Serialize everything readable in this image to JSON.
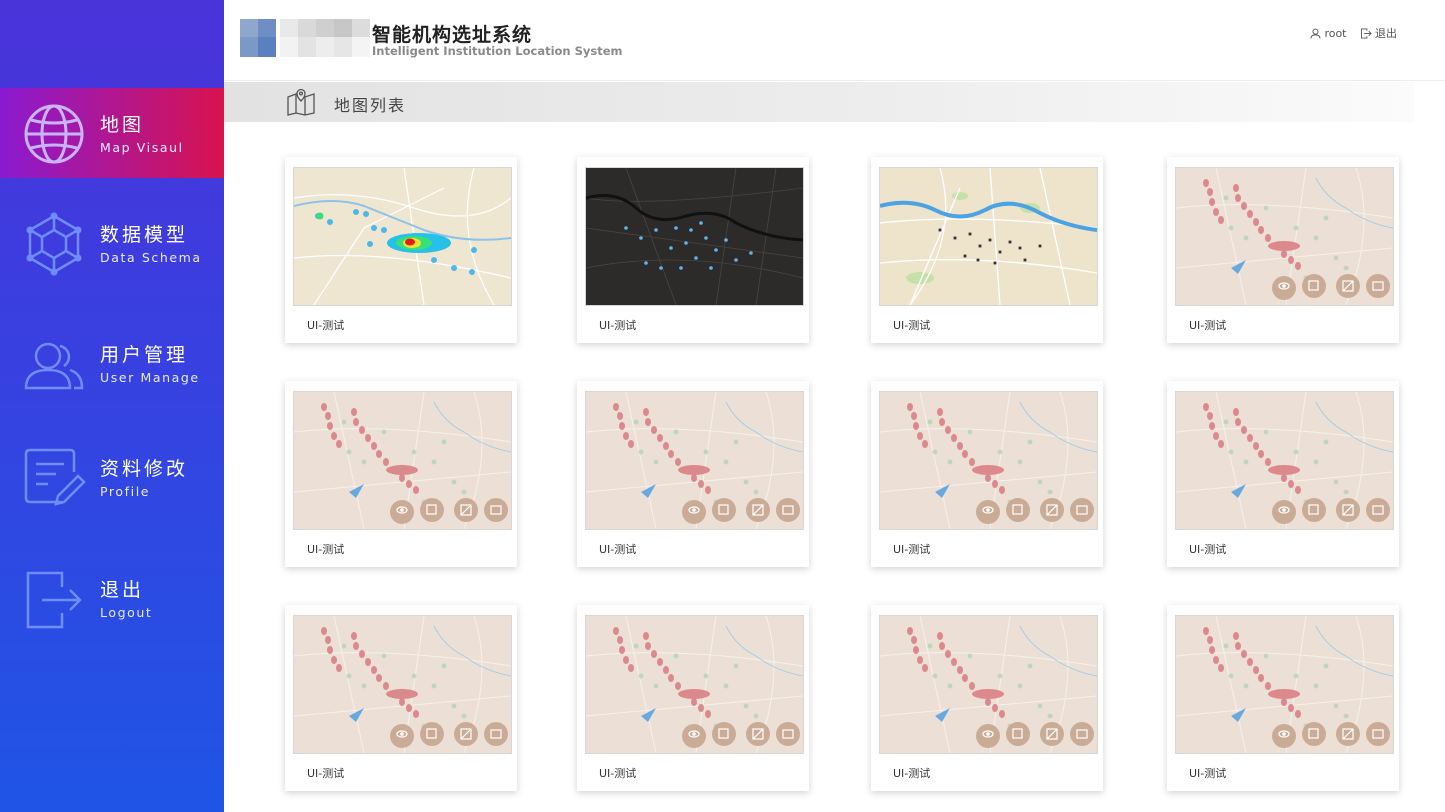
{
  "app": {
    "title_cn": "智能机构选址系统",
    "title_en": "Intelligent Institution Location System",
    "user": "root",
    "logout": "退出"
  },
  "nav": [
    {
      "cn": "地图",
      "en": "Map Visaul",
      "icon": "globe-icon",
      "active": true
    },
    {
      "cn": "数据模型",
      "en": "Data Schema",
      "icon": "network-icon",
      "active": false
    },
    {
      "cn": "用户管理",
      "en": "User Manage",
      "icon": "users-icon",
      "active": false
    },
    {
      "cn": "资料修改",
      "en": "Profile",
      "icon": "edit-icon",
      "active": false
    },
    {
      "cn": "退出",
      "en": "Logout",
      "icon": "logout-icon",
      "active": false
    }
  ],
  "section": {
    "title": "地图列表",
    "icon": "map-icon"
  },
  "maps": [
    {
      "label": "UI-测试",
      "style": "heatmap"
    },
    {
      "label": "UI-测试",
      "style": "dark"
    },
    {
      "label": "UI-测试",
      "style": "streets"
    },
    {
      "label": "UI-测试",
      "style": "points"
    },
    {
      "label": "UI-测试",
      "style": "points"
    },
    {
      "label": "UI-测试",
      "style": "points"
    },
    {
      "label": "UI-测试",
      "style": "points"
    },
    {
      "label": "UI-测试",
      "style": "points"
    },
    {
      "label": "UI-测试",
      "style": "points"
    },
    {
      "label": "UI-测试",
      "style": "points"
    },
    {
      "label": "UI-测试",
      "style": "points"
    },
    {
      "label": "UI-测试",
      "style": "points"
    }
  ],
  "colors": {
    "sidebar_top": "#4a33d9",
    "sidebar_bottom": "#1f55e6",
    "active_from": "#8a1ad0",
    "active_to": "#d8134f"
  }
}
